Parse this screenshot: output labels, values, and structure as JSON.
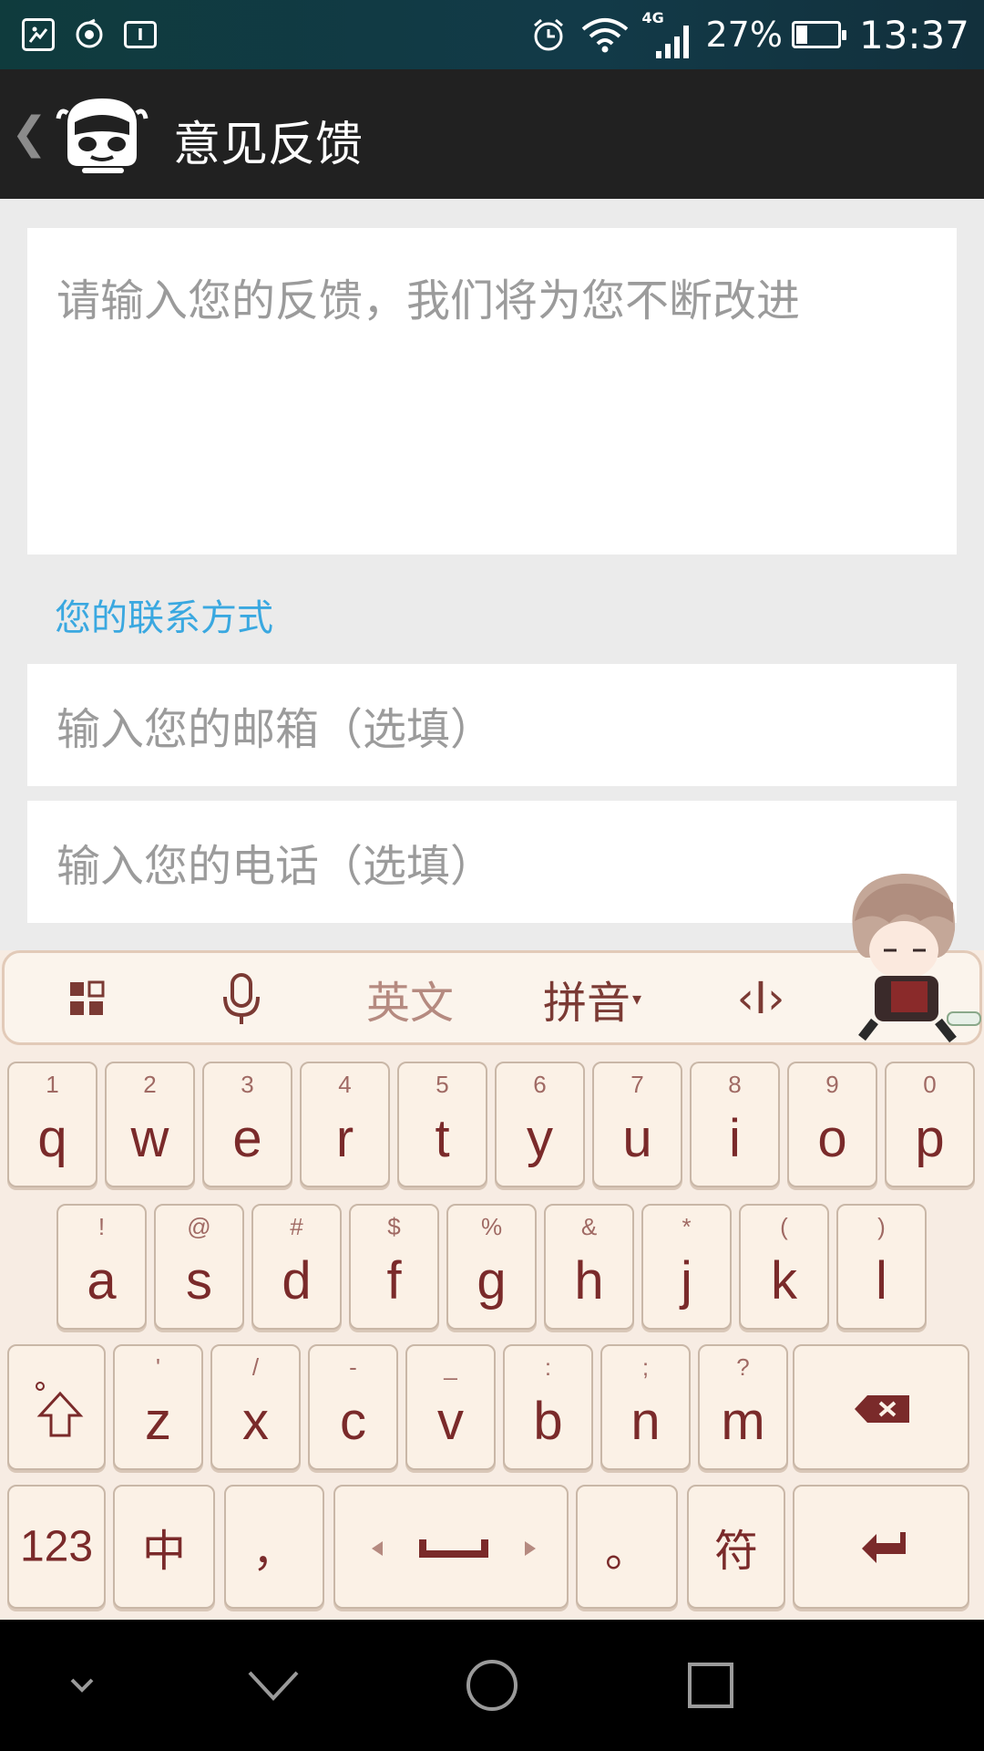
{
  "status_bar": {
    "time": "13:37",
    "battery_percent": "27%",
    "battery_level": 0.27,
    "network": "4G",
    "left_icons": [
      "gallery-icon",
      "sync-icon",
      "input-method-icon"
    ],
    "right_icons": [
      "alarm-icon",
      "wifi-icon",
      "signal-icon",
      "battery-icon"
    ]
  },
  "app_bar": {
    "back_glyph": "❮",
    "title": "意见反馈"
  },
  "form": {
    "feedback_placeholder": "请输入您的反馈，我们将为您不断改进",
    "contact_label": "您的联系方式",
    "email_placeholder": "输入您的邮箱（选填）",
    "phone_placeholder": "输入您的电话（选填）"
  },
  "keyboard": {
    "toolbar": {
      "english": "英文",
      "pinyin": "拼音",
      "cursor": "‹I›"
    },
    "row1": [
      {
        "key": "q",
        "sub": "1"
      },
      {
        "key": "w",
        "sub": "2"
      },
      {
        "key": "e",
        "sub": "3"
      },
      {
        "key": "r",
        "sub": "4"
      },
      {
        "key": "t",
        "sub": "5"
      },
      {
        "key": "y",
        "sub": "6"
      },
      {
        "key": "u",
        "sub": "7"
      },
      {
        "key": "i",
        "sub": "8"
      },
      {
        "key": "o",
        "sub": "9"
      },
      {
        "key": "p",
        "sub": "0"
      }
    ],
    "row2": [
      {
        "key": "a",
        "sub": "!"
      },
      {
        "key": "s",
        "sub": "@"
      },
      {
        "key": "d",
        "sub": "#"
      },
      {
        "key": "f",
        "sub": "$"
      },
      {
        "key": "g",
        "sub": "%"
      },
      {
        "key": "h",
        "sub": "&"
      },
      {
        "key": "j",
        "sub": "*"
      },
      {
        "key": "k",
        "sub": "("
      },
      {
        "key": "l",
        "sub": ")"
      }
    ],
    "row3": [
      {
        "key": "z",
        "sub": "'"
      },
      {
        "key": "x",
        "sub": "/"
      },
      {
        "key": "c",
        "sub": "-"
      },
      {
        "key": "v",
        "sub": "_"
      },
      {
        "key": "b",
        "sub": ":"
      },
      {
        "key": "n",
        "sub": ";"
      },
      {
        "key": "m",
        "sub": "?"
      }
    ],
    "row4": {
      "numbers": "123",
      "chinese": "中",
      "comma": "，",
      "period": "。",
      "symbols": "符"
    }
  },
  "colors": {
    "accent": "#3aa8e0",
    "app_bar": "#212121",
    "key_text": "#7a2a2a"
  }
}
